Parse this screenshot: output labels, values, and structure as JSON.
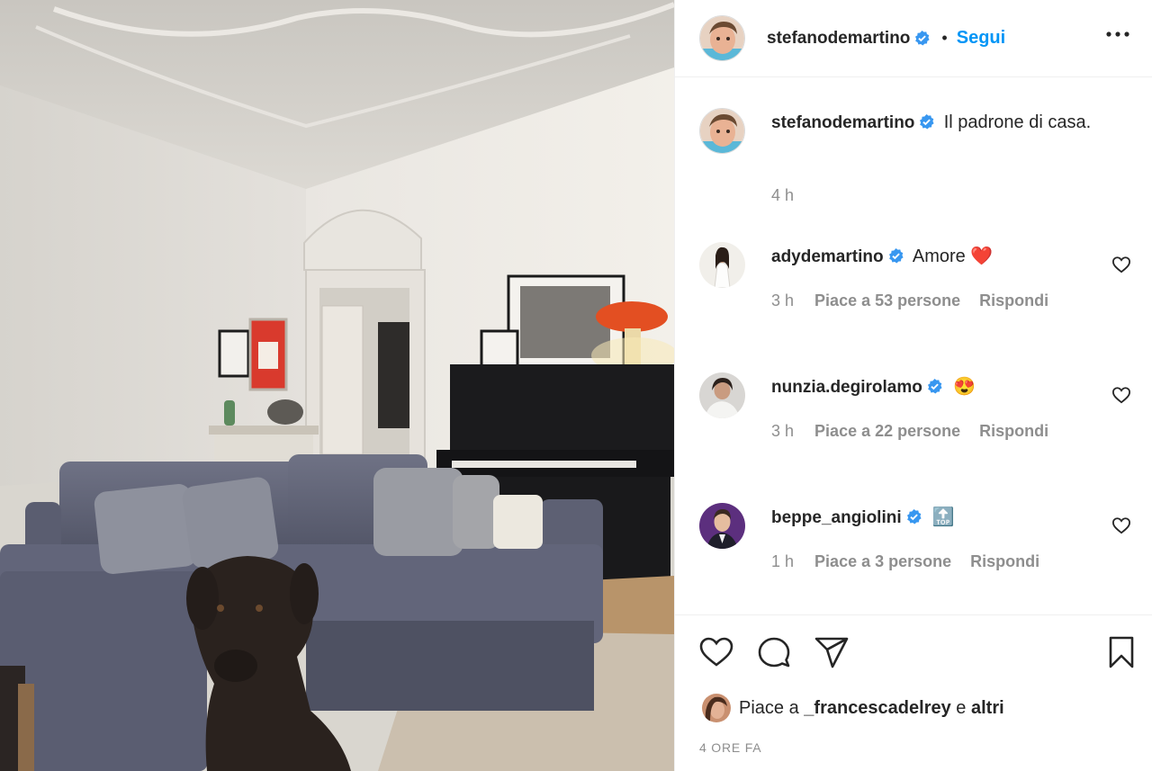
{
  "post": {
    "author": "stefanodemartino",
    "follow_label": "Segui",
    "separator": "•",
    "caption": "Il padrone di casa.",
    "caption_time": "4 h"
  },
  "comments": [
    {
      "user": "adydemartino",
      "text": "Amore",
      "emoji": "❤️",
      "time": "3 h",
      "likes": "Piace a 53 persone",
      "reply": "Rispondi"
    },
    {
      "user": "nunzia.degirolamo",
      "text": "",
      "emoji": "😍",
      "time": "3 h",
      "likes": "Piace a 22 persone",
      "reply": "Rispondi"
    },
    {
      "user": "beppe_angiolini",
      "text": "",
      "emoji": "🔝",
      "time": "1 h",
      "likes": "Piace a 3 persone",
      "reply": "Rispondi"
    }
  ],
  "likes_line": {
    "prefix": "Piace a",
    "user": "_francescadelrey",
    "middle": "e",
    "suffix": "altri"
  },
  "date": "4 ORE FA",
  "colors": {
    "accent": "#0095f6",
    "verified": "#3897f0",
    "muted": "#8e8e8e",
    "text": "#262626"
  },
  "icons": [
    "more-options-icon",
    "verified-badge-icon",
    "heart-icon",
    "comment-icon",
    "share-icon",
    "bookmark-icon"
  ]
}
